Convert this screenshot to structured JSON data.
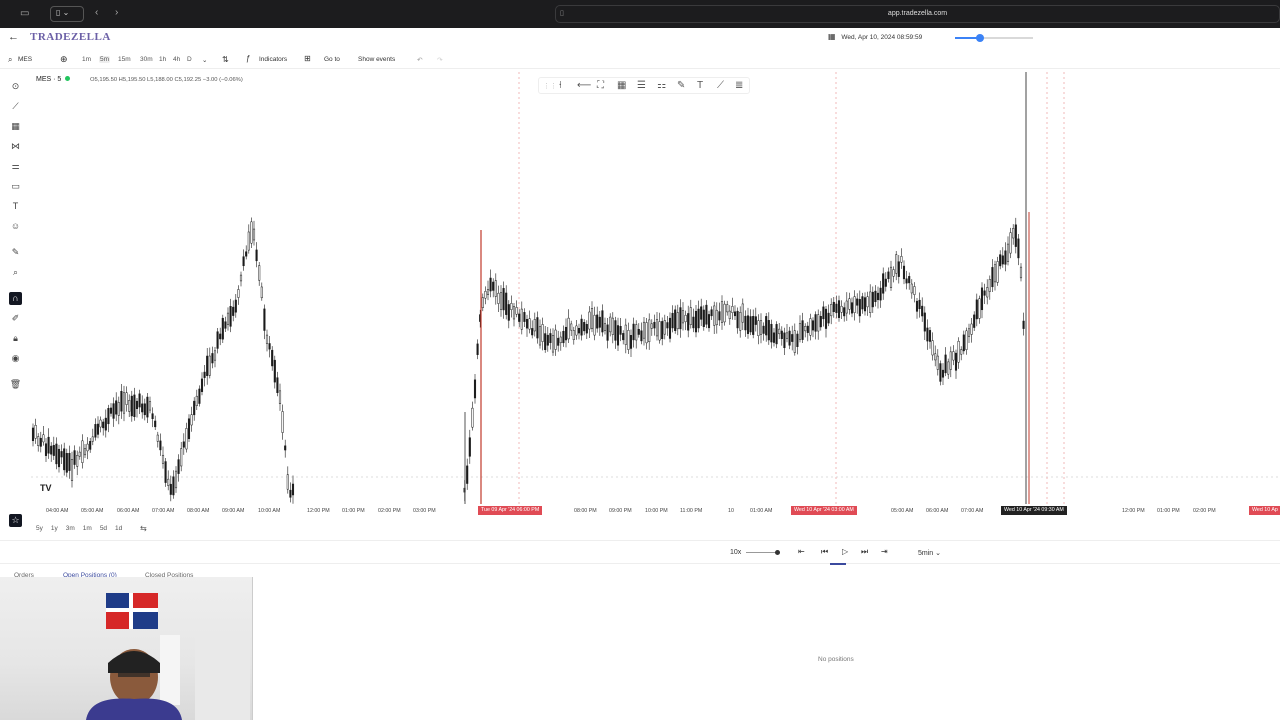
{
  "browser": {
    "url": "app.tradezella.com"
  },
  "app": {
    "logo": "TRADEZELLA",
    "replay_datetime": "Wed, Apr 10, 2024 08:59:59",
    "speed_progress": 0.32
  },
  "toolbar": {
    "symbol_search": "MES",
    "timeframes": [
      "1m",
      "5m",
      "15m",
      "30m",
      "1h",
      "4h",
      "D"
    ],
    "active_timeframe": "5m",
    "indicators_label": "Indicators",
    "goto_label": "Go to",
    "show_events_label": "Show events"
  },
  "chart": {
    "symbol": "MES · 5",
    "ohlc": "O5,195.50 H5,195.50 L5,188.00 C5,192.25 −3.00 (−0.06%)",
    "time_labels": [
      "04:00 AM",
      "05:00 AM",
      "06:00 AM",
      "07:00 AM",
      "08:00 AM",
      "09:00 AM",
      "10:00 AM",
      "12:00 PM",
      "01:00 PM",
      "02:00 PM",
      "03:00 PM",
      "08:00 PM",
      "09:00 PM",
      "10:00 PM",
      "11:00 PM",
      "10",
      "01:00 AM",
      "05:00 AM",
      "06:00 AM",
      "07:00 AM",
      "12:00 PM",
      "01:00 PM",
      "02:00 PM"
    ],
    "highlight_1": "Tue 09 Apr '24   06:00 PM",
    "highlight_2": "Wed 10 Apr '24   03:00 AM",
    "highlight_3": "Wed 10 Apr '24   09:30 AM",
    "highlight_4": "Wed 10 Ap",
    "tv_logo": "TV"
  },
  "ranges": [
    "5y",
    "1y",
    "3m",
    "1m",
    "5d",
    "1d"
  ],
  "playback": {
    "speed": "10x",
    "interval": "5min",
    "speed_progress": 1.0
  },
  "panel": {
    "tabs": [
      "Orders",
      "Open Positions (0)",
      "Closed Positions"
    ],
    "empty_text": "No positions"
  },
  "colors": {
    "accent": "#3b82f6",
    "highlight": "#e04b55",
    "candle": "#1a1a1a",
    "tab_active": "#3b4a9e"
  }
}
